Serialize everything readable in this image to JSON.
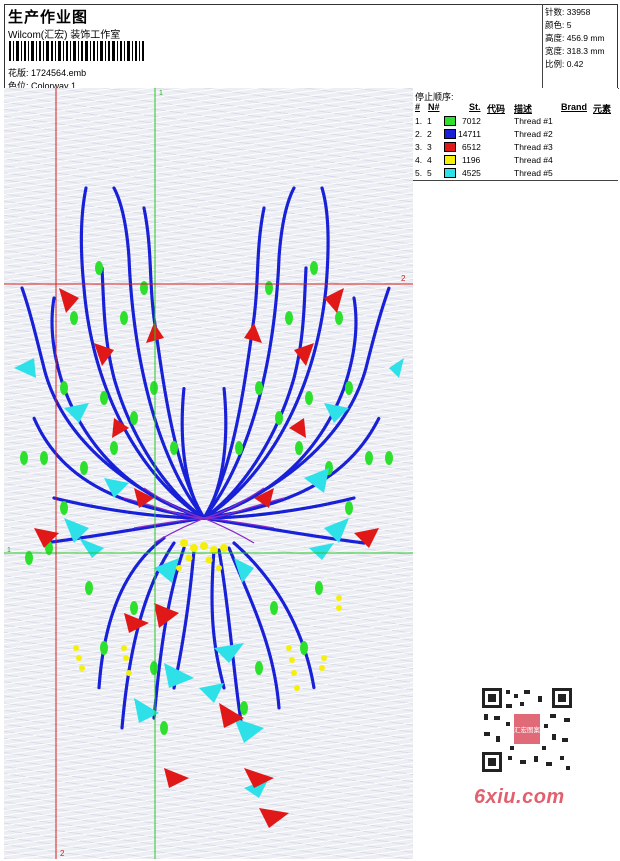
{
  "header": {
    "title": "生产作业图",
    "studio": "Wilcom(汇宏) 装饰工作室",
    "barcode_digits": "| | | | | | | | | | | | | | | | | | | | | |",
    "design_label": "花版:",
    "design_value": "1724564.emb",
    "colorway_label": "色位:",
    "colorway_value": "Colorway 1"
  },
  "stats": [
    {
      "label": "针数:",
      "value": "33958"
    },
    {
      "label": "颜色:",
      "value": "5"
    },
    {
      "label": "高度:",
      "value": "456.9 mm"
    },
    {
      "label": "宽度:",
      "value": "318.3 mm"
    },
    {
      "label": "比例:",
      "value": "0.42"
    }
  ],
  "canvas": {
    "guide_top_left": "1",
    "guide_right_top": "2",
    "guide_left_mid": "1",
    "guide_bottom": "2",
    "guide_color_red": "#d41c1c",
    "guide_color_green": "#25c825"
  },
  "thread_panel": {
    "title": "停止顺序:",
    "headers": {
      "num": "#",
      "n": "N#",
      "st": "St.",
      "code": "代码",
      "desc": "描述",
      "brand": "Brand",
      "element": "元素"
    },
    "rows": [
      {
        "num": "1.",
        "n": "1",
        "color": "#2ee02e",
        "code": "7012",
        "desc": "Thread #1"
      },
      {
        "num": "2.",
        "n": "2",
        "color": "#1820d8",
        "code": "14711",
        "desc": "Thread #2"
      },
      {
        "num": "3.",
        "n": "3",
        "color": "#e01818",
        "code": "6512",
        "desc": "Thread #3"
      },
      {
        "num": "4.",
        "n": "4",
        "color": "#f4f00c",
        "code": "1196",
        "desc": "Thread #4"
      },
      {
        "num": "5.",
        "n": "5",
        "color": "#2ee0e8",
        "code": "4525",
        "desc": "Thread #5"
      }
    ]
  },
  "watermark": {
    "qr_label": "汇宏图案",
    "site": "6xiu.com"
  }
}
